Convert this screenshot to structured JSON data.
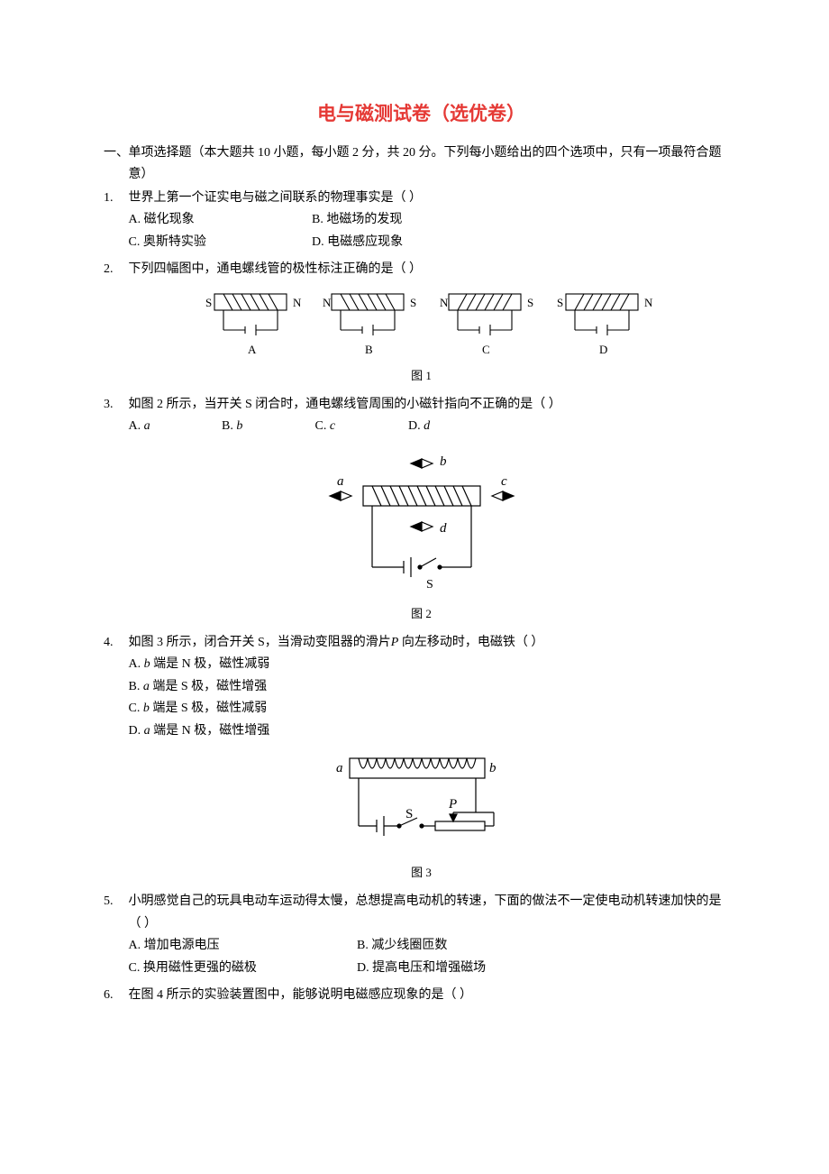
{
  "title": "电与磁测试卷（选优卷）",
  "section1": {
    "heading_prefix": "一、",
    "heading": "单项选择题（本大题共 10 小题，每小题 2 分，共 20 分。下列每小题给出的四个选项中，只有一项最符合题意）"
  },
  "q1": {
    "num": "1.",
    "text": "世界上第一个证实电与磁之间联系的物理事实是（      ）",
    "A": "A. 磁化现象",
    "B": "B. 地磁场的发现",
    "C": "C. 奥斯特实验",
    "D": "D. 电磁感应现象"
  },
  "q2": {
    "num": "2.",
    "text": "下列四幅图中，通电螺线管的极性标注正确的是（      ）",
    "figcap": "图 1",
    "labels": {
      "A": "A",
      "B": "B",
      "C": "C",
      "D": "D",
      "S": "S",
      "N": "N"
    }
  },
  "q3": {
    "num": "3.",
    "text": "如图 2 所示，当开关 S 闭合时，通电螺线管周围的小磁针指向不正确的是（      ）",
    "A": "A.",
    "Av": "a",
    "B": "B.",
    "Bv": "b",
    "C": "C.",
    "Cv": "c",
    "D": "D.",
    "Dv": "d",
    "figcap": "图 2",
    "labels": {
      "a": "a",
      "b": "b",
      "c": "c",
      "d": "d",
      "S": "S"
    }
  },
  "q4": {
    "num": "4.",
    "text_pre": "如图 3 所示，闭合开关 S，当滑动变阻器的滑片",
    "P": "P",
    "text_post": " 向左移动时，电磁铁（      ）",
    "A_pre": "A.",
    "A_v": "b",
    "A_post": " 端是 N 极，磁性减弱",
    "B_pre": "B.",
    "B_v": "a",
    "B_post": " 端是 S 极，磁性增强",
    "C_pre": "C.",
    "C_v": "b",
    "C_post": " 端是 S 极，磁性减弱",
    "D_pre": "D.",
    "D_v": "a",
    "D_post": " 端是 N 极，磁性增强",
    "figcap": "图 3",
    "labels": {
      "a": "a",
      "b": "b",
      "S": "S",
      "P": "P"
    }
  },
  "q5": {
    "num": "5.",
    "text": "小明感觉自己的玩具电动车运动得太慢，总想提高电动机的转速，下面的做法不一定使电动机转速加快的是（      ）",
    "A": "A. 增加电源电压",
    "B": "B. 减少线圈匝数",
    "C": "C. 换用磁性更强的磁极",
    "D": "D. 提高电压和增强磁场"
  },
  "q6": {
    "num": "6.",
    "text": "在图 4 所示的实验装置图中，能够说明电磁感应现象的是（      ）"
  }
}
